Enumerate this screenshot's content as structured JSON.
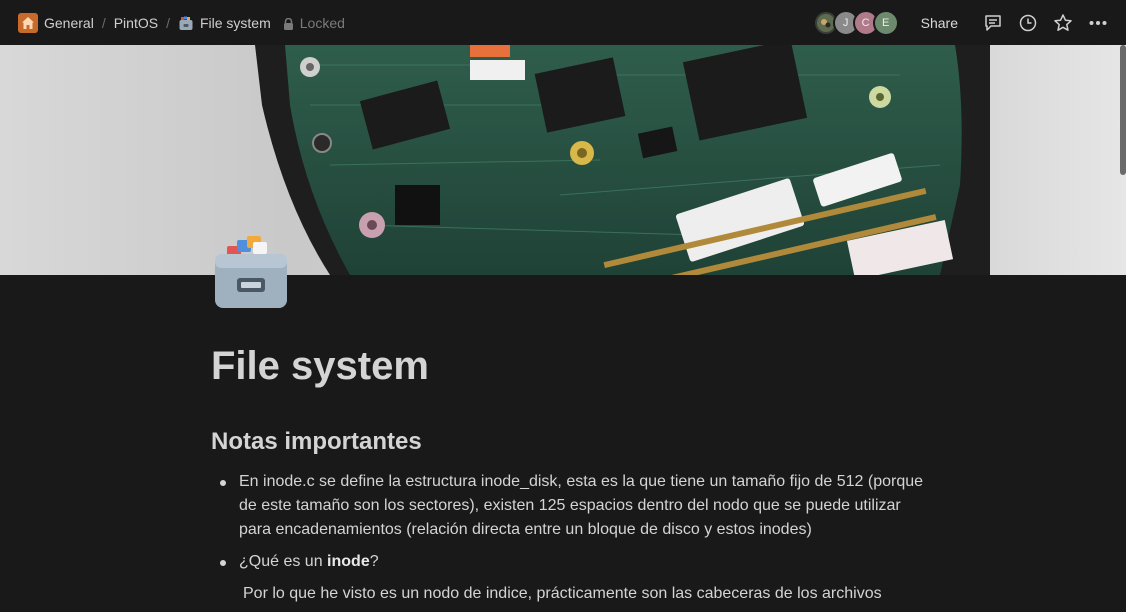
{
  "breadcrumb": {
    "items": [
      {
        "label": "General",
        "icon": "home-icon"
      },
      {
        "label": "PintOS"
      },
      {
        "label": "File system",
        "icon": "card-file-box-icon"
      },
      {
        "label": "Locked",
        "icon": "lock-icon"
      }
    ],
    "separator": "/"
  },
  "topbar": {
    "avatars": [
      "J",
      "C",
      "E"
    ],
    "share_label": "Share"
  },
  "page": {
    "title": "File system",
    "heading": "Notas importantes",
    "bullets": [
      {
        "text": "En inode.c se define la estructura inode_disk, esta es la que tiene un tamaño fijo de 512 (porque de este tamaño son los sectores), existen 125 espacios dentro del nodo que se puede utilizar para encadenamientos (relación directa entre un bloque de disco y estos inodes)"
      },
      {
        "pre": "¿Qué es un ",
        "bold": "inode",
        "post": "?"
      }
    ],
    "paragraph": "Por lo que he visto es un nodo de indice, prácticamente son las cabeceras de los archivos"
  },
  "colors": {
    "background": "#191919",
    "text": "#d4d4d4",
    "home_icon_bg": "#c86a2b",
    "avatar_j": "#8a8a8a",
    "avatar_c": "#b07a8a",
    "avatar_e": "#6e8a6e"
  }
}
